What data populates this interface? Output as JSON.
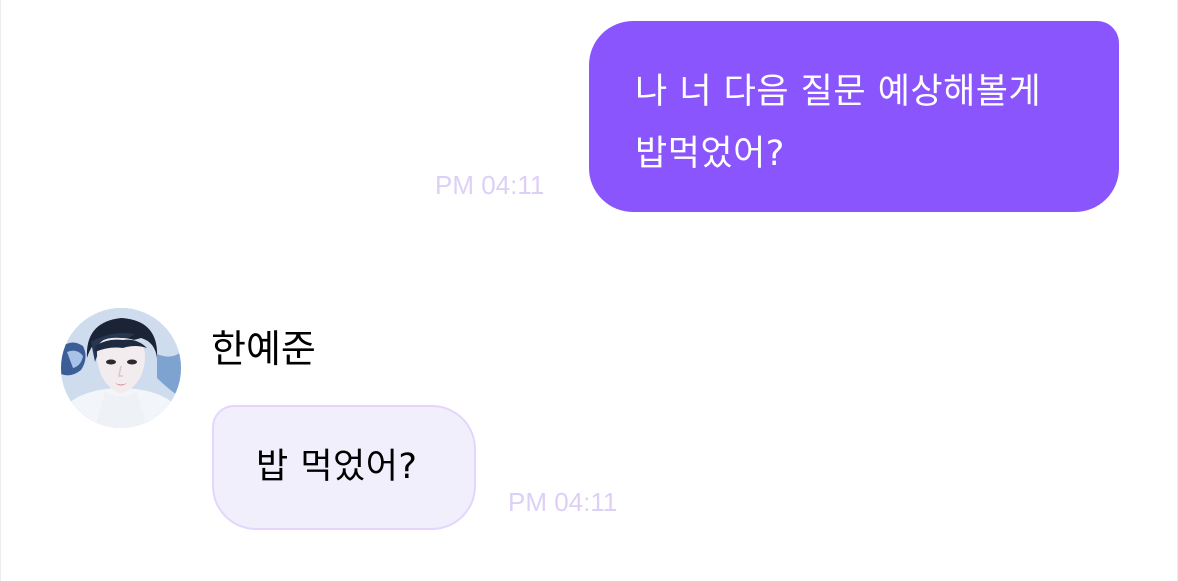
{
  "messages": [
    {
      "direction": "outgoing",
      "lines": [
        "나 너 다음 질문 예상해볼게",
        "밥먹었어?"
      ],
      "time": "PM 04:11"
    },
    {
      "direction": "incoming",
      "sender": "한예준",
      "text": "밥 먹었어?",
      "time": "PM 04:11"
    }
  ],
  "colors": {
    "outgoing_bubble": "#8b55fd",
    "incoming_bubble": "#f1effc",
    "incoming_border": "#e4d6fb",
    "timestamp": "#ddd0f7"
  }
}
